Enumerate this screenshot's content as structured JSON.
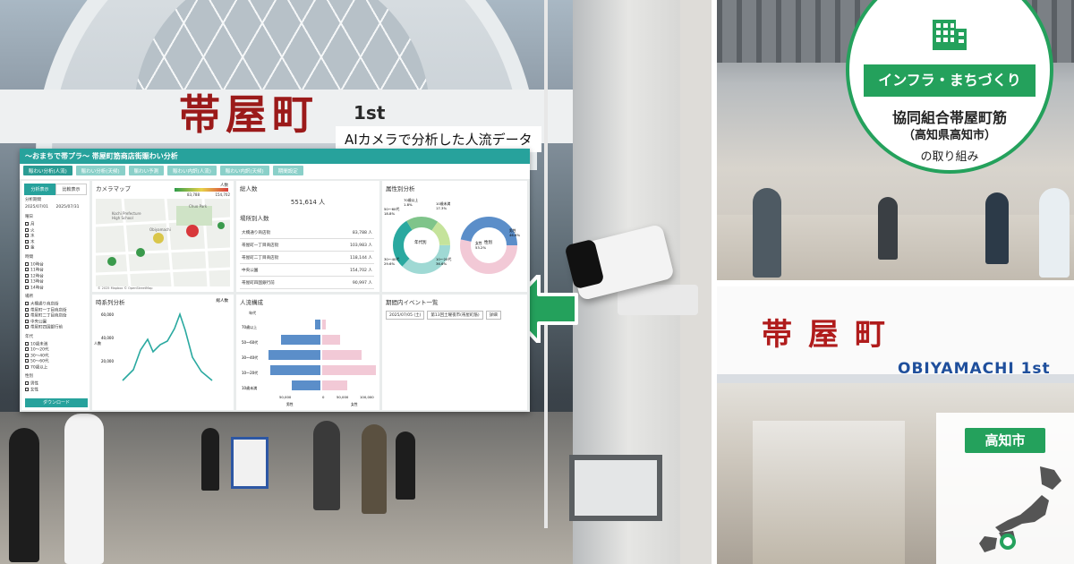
{
  "main_photo": {
    "sign_kanji": "帯屋町",
    "sign_sub": "1st"
  },
  "dashboard": {
    "caption": "AIカメラで分析した人流データ",
    "header": "〜おまちで帯プラ〜 帯屋町筋商店街賑わい分析",
    "tabs": [
      "賑わい分析(人流)",
      "賑わい分析(天候)",
      "賑わい予測",
      "賑わい内訳(人流)",
      "賑わい内訳(天候)",
      "期間設定"
    ],
    "side": {
      "toggle": [
        "分析表示",
        "比較表示"
      ],
      "period_label": "分析期間",
      "date_from": "2025/07/01",
      "date_to": "2025/07/31",
      "weekday_label": "曜日",
      "weekdays": [
        "月",
        "火",
        "水",
        "木",
        "金"
      ],
      "time_label": "時間",
      "times": [
        "10時台",
        "11時台",
        "12時台",
        "13時台",
        "14時台"
      ],
      "place_label": "場所",
      "places": [
        "大橋通り商店街",
        "帯屋町一丁目商店街",
        "帯屋町二丁目商店街",
        "中央公園",
        "帯屋町四国銀行前"
      ],
      "age_label": "年代",
      "ages": [
        "10歳未満",
        "10〜20代",
        "30〜40代",
        "50〜60代",
        "70歳以上"
      ],
      "gender_label": "性別",
      "genders": [
        "男性",
        "女性"
      ],
      "download": "ダウンロード"
    },
    "map": {
      "title": "カメラマップ",
      "legend_title": "人数",
      "legend_min": "83,788",
      "legend_max": "154,702",
      "credit": "© 2025 Mapbox © OpenStreetMap",
      "place_labels": [
        "Kochi Prefecture High School",
        "Obiyamachi",
        "Chuo Park"
      ]
    },
    "total": {
      "title": "総人数",
      "value": "551,614 人"
    },
    "by_place": {
      "title": "場所別人数",
      "rows": [
        {
          "name": "大橋通り商店街",
          "value": "83,788 人"
        },
        {
          "name": "帯屋町一丁目商店街",
          "value": "103,983 人"
        },
        {
          "name": "帯屋町二丁目商店街",
          "value": "118,144 人"
        },
        {
          "name": "中央公園",
          "value": "154,702 人"
        },
        {
          "name": "帯屋町四国銀行前",
          "value": "90,997 人"
        }
      ]
    },
    "attributes": {
      "title": "属性別分析",
      "donut1_center": "年代別",
      "donut2_center": "性別",
      "labels": [
        {
          "text": "70歳以上",
          "value": "1.8%"
        },
        {
          "text": "10歳未満",
          "value": "17.3%"
        },
        {
          "text": "50〜60代",
          "value": "18.8%"
        },
        {
          "text": "30〜40代",
          "value": "29.6%"
        },
        {
          "text": "10〜20代",
          "value": "36.6%"
        },
        {
          "text": "女性",
          "value": "53.2%"
        },
        {
          "text": "男性",
          "value": "46.8%"
        }
      ]
    },
    "timeseries": {
      "title": "時系列分析",
      "unit": "総人数",
      "y_ticks": [
        "60,000",
        "40,000",
        "20,000"
      ],
      "ylabel": "人数"
    },
    "pyramid": {
      "title": "人流構成",
      "age_header": "年代",
      "rows": [
        "70歳以上",
        "50〜60代",
        "30〜40代",
        "10〜20代",
        "10歳未満"
      ],
      "x_ticks": [
        "50,000",
        "0",
        "50,000",
        "100,000"
      ],
      "male": "男性",
      "female": "女性"
    },
    "events": {
      "title": "期間内イベント一覧",
      "row": [
        "2025/07/05 (土)",
        "第13回土曜夜市(帯屋町筋)",
        "詳細"
      ]
    }
  },
  "badge": {
    "category": "インフラ・まちづくり",
    "org_line1": "協同組合帯屋町筋",
    "org_line2": "（高知県高知市）",
    "suffix": "の取り組み",
    "icon": "building-icon"
  },
  "right_bottom_photo": {
    "sign_kanji": "帯屋町",
    "sign_roman": "OBIYAMACHI 1st"
  },
  "map_box": {
    "label": "高知市",
    "icon": "japan-map-icon"
  },
  "colors": {
    "green": "#24a15c",
    "teal": "#27a29c",
    "red_sign": "#b01c1c"
  }
}
